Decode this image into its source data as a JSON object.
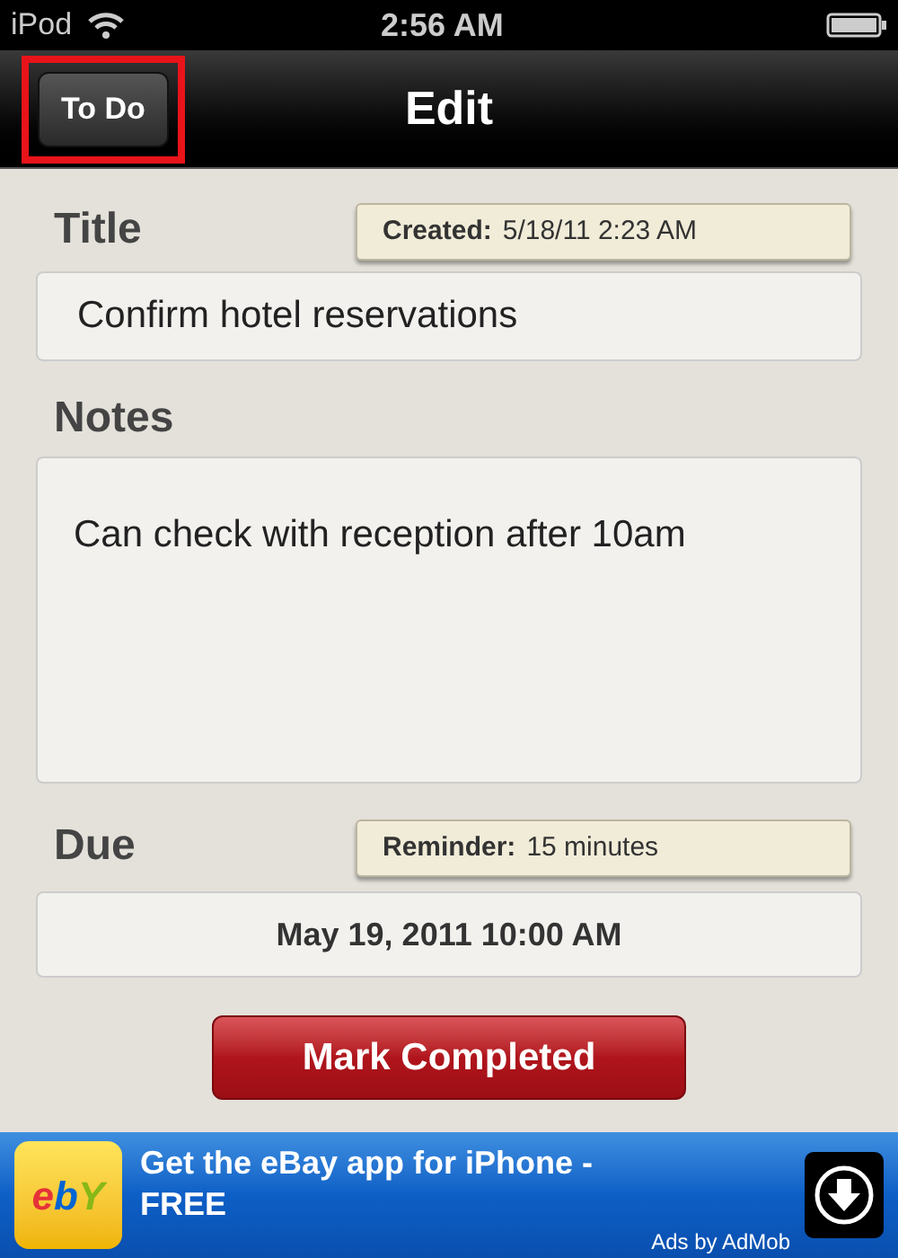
{
  "status_bar": {
    "device": "iPod",
    "time": "2:56 AM"
  },
  "nav_bar": {
    "back_button": {
      "label": "To Do",
      "highlighted": true
    },
    "title": "Edit"
  },
  "title_section": {
    "label": "Title",
    "badge_label": "Created:",
    "badge_value": "5/18/11 2:23 AM",
    "value": "Confirm hotel reservations"
  },
  "notes_section": {
    "label": "Notes",
    "value": "Can check with reception after 10am"
  },
  "due_section": {
    "label": "Due",
    "badge_label": "Reminder:",
    "badge_value": "15 minutes",
    "value": "May 19, 2011 10:00 AM"
  },
  "action_button": "Mark Completed",
  "ad": {
    "logo_letters": [
      {
        "char": "e",
        "color": "#e53238"
      },
      {
        "char": "b",
        "color": "#0064d2"
      },
      {
        "char": "Y",
        "color": "#86b817"
      }
    ],
    "text": "Get the eBay app for iPhone - FREE",
    "credit": "Ads by AdMob"
  }
}
